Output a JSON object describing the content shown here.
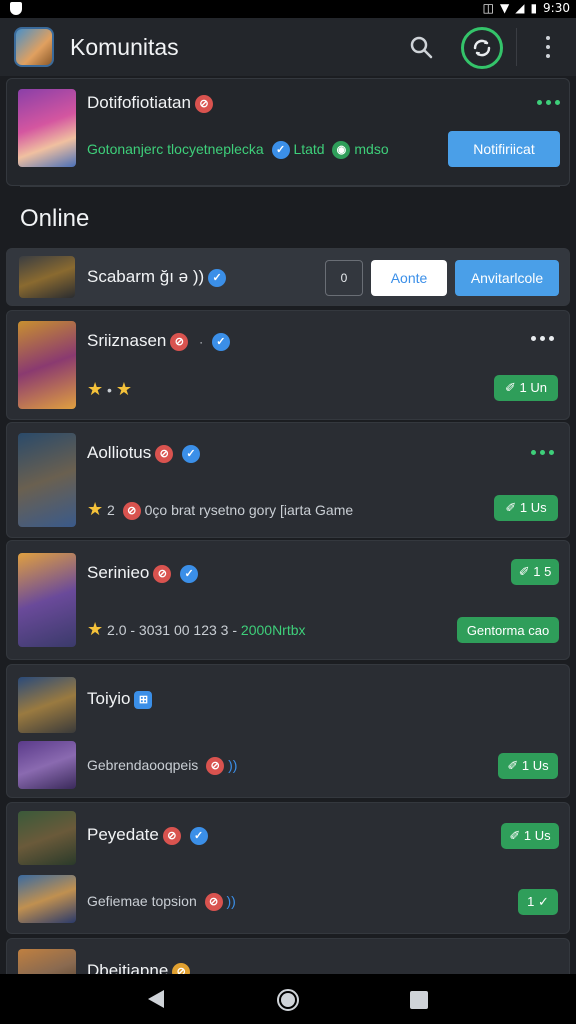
{
  "status_bar": {
    "time": "9:30"
  },
  "app_bar": {
    "title": "Komunitas",
    "icons": [
      "search-icon",
      "sync-icon",
      "more-vert-icon"
    ]
  },
  "featured": {
    "name": "Dotifofiotiatan",
    "description": "Gotonanjerc tlocyetneplecka",
    "tag_text": "Ltatd",
    "extra_text": "mdso",
    "action_label": "Notifiriicat"
  },
  "section_title": "Online",
  "online_user": {
    "name": "Scabarm ğı ə ))",
    "count_label": "0",
    "accept_label": "Aonte",
    "add_label": "Anvitarlcole"
  },
  "players": [
    {
      "name": "Sriiznasen",
      "rating_text": "•",
      "pill": "✐ 1 Un"
    },
    {
      "name": "Aolliotus",
      "rating_text": "2",
      "info": "0ço brat rysetno gory [iarta Game",
      "pill": "✐ 1 Us"
    },
    {
      "name": "Serinieo",
      "rating_text": "2.0  -  3031 00 123 3  -",
      "info_green": "2000Nrtbx",
      "pill_top": "✐ 1 5",
      "pill": "Gentorma cao"
    },
    {
      "name": "Toiyio",
      "sub_name": "Gebrendaooqpeis",
      "pill": "✐ 1 Us"
    },
    {
      "name": "Peyedate",
      "sub_name": "Gefiemae topsion",
      "pill_top": "✐ 1 Us",
      "pill": "1 ✓"
    },
    {
      "name": "Dbeitiapne"
    }
  ],
  "colors": {
    "accent_green": "#2f9e5a",
    "accent_blue": "#4a9fe8",
    "badge_red": "#d9534f",
    "badge_blue": "#3b8fe8"
  }
}
